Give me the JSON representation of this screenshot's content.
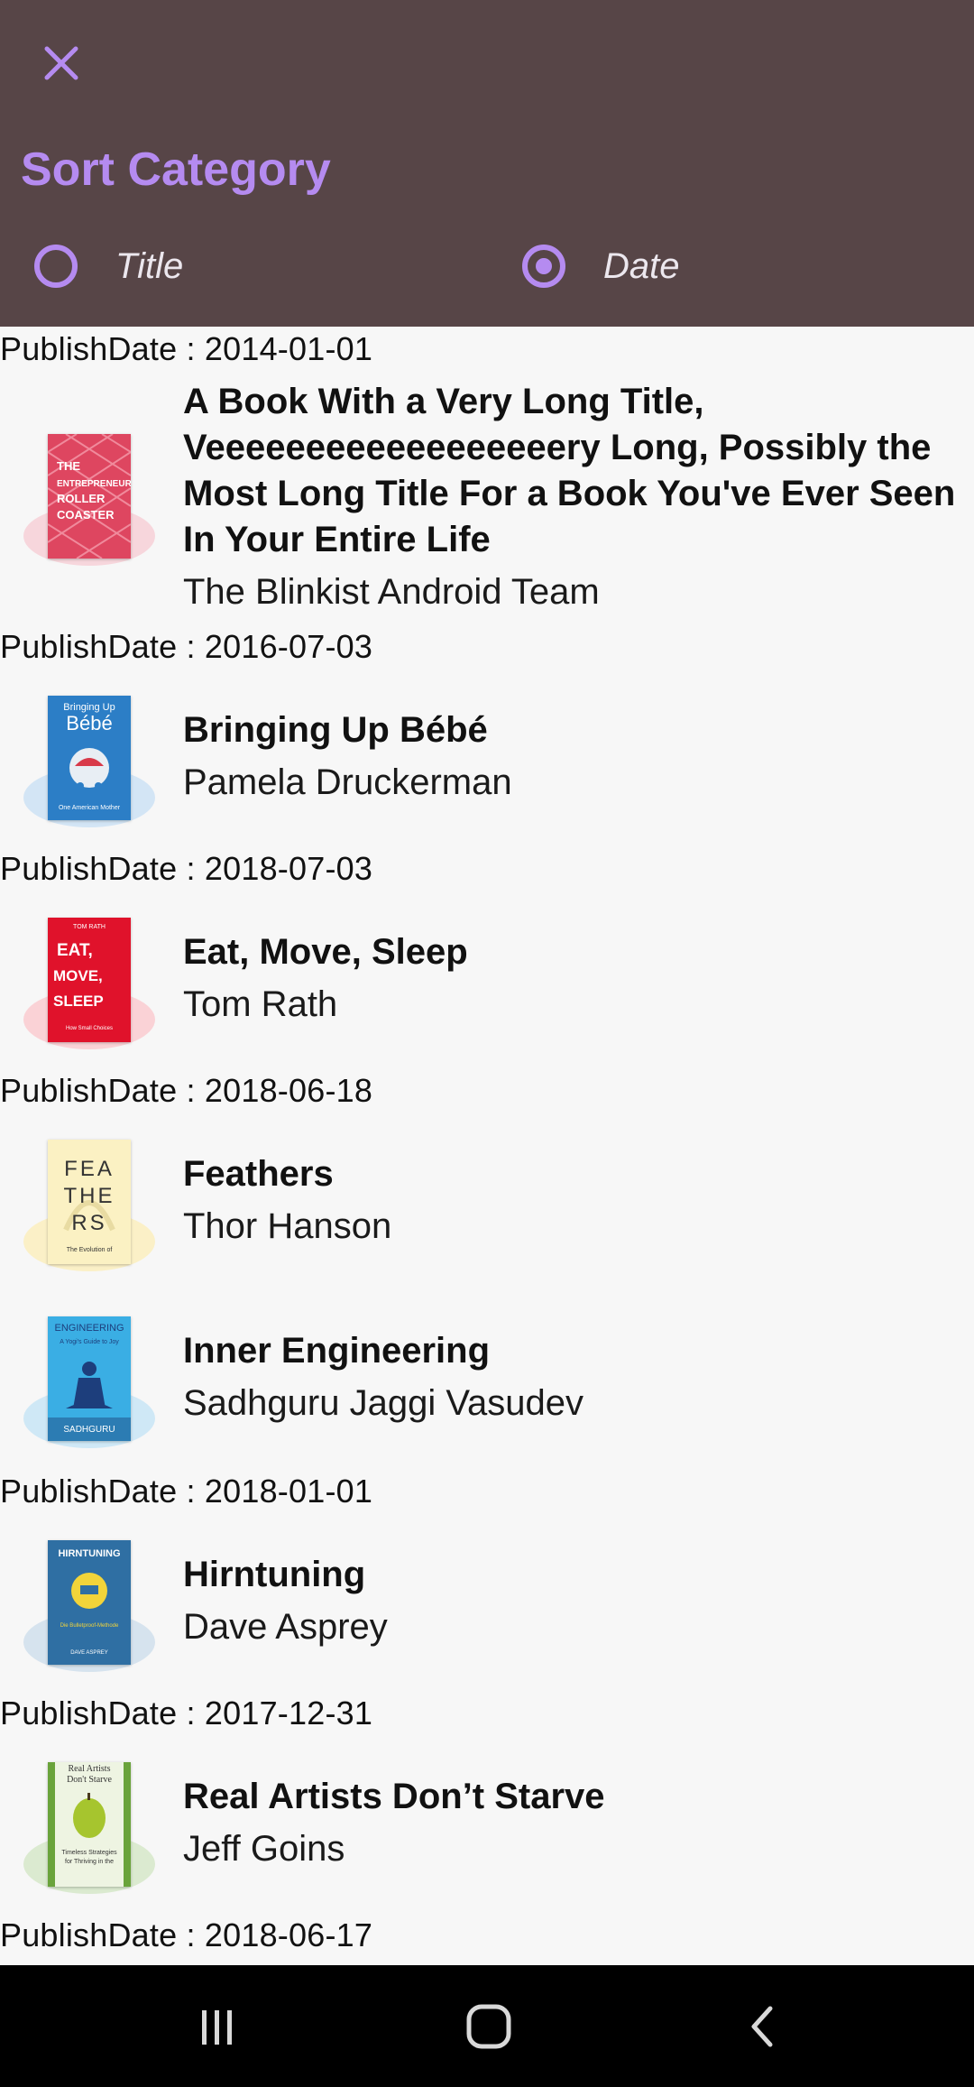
{
  "header": {
    "title": "Sort Category",
    "options": [
      {
        "label": "Title",
        "checked": false
      },
      {
        "label": "Date",
        "checked": true
      }
    ],
    "accent": "#b58bf0",
    "background": "#574547"
  },
  "list": {
    "date_headers": [
      "PublishDate : 2014-01-01",
      "PublishDate : 2016-07-03",
      "PublishDate : 2018-07-03",
      "PublishDate : 2018-06-18",
      "PublishDate : 2018-01-01",
      "PublishDate : 2017-12-31",
      "PublishDate : 2018-06-17"
    ],
    "books": [
      {
        "title": "A Book With a Very Long Title, Veeeeeeeeeeeeeeeeeery Long, Possibly the Most Long Title For a Book You've Ever Seen In Your Entire Life",
        "author": "The Blinkist Android Team",
        "cover_text": "THE ENTREPRENEUR ROLLER COASTER",
        "cover_color": "#e0445f"
      },
      {
        "title": "Bringing Up Bébé",
        "author": "Pamela Druckerman",
        "cover_text": "Bringing Up Bébé",
        "cover_color": "#2f7fc8"
      },
      {
        "title": "Eat, Move, Sleep",
        "author": "Tom Rath",
        "cover_text": "EAT, MOVE, SLEEP",
        "cover_color": "#e0122b"
      },
      {
        "title": "Feathers",
        "author": "Thor Hanson",
        "cover_text": "FEA THE RS",
        "cover_color": "#fbf1c3"
      },
      {
        "title": "Inner Engineering",
        "author": "Sadhguru Jaggi Vasudev",
        "cover_text": "ENGINEERING",
        "cover_color": "#3aaee4"
      },
      {
        "title": "Hirntuning",
        "author": "Dave Asprey",
        "cover_text": "HIRNTUNING",
        "cover_color": "#2f6fa3"
      },
      {
        "title": "Real Artists Don’t Starve",
        "author": "Jeff Goins",
        "cover_text": "Real Artists Don't Starve",
        "cover_color": "#6aa33b"
      }
    ]
  },
  "nav": {
    "icons": [
      "recents-icon",
      "home-icon",
      "back-icon"
    ]
  }
}
